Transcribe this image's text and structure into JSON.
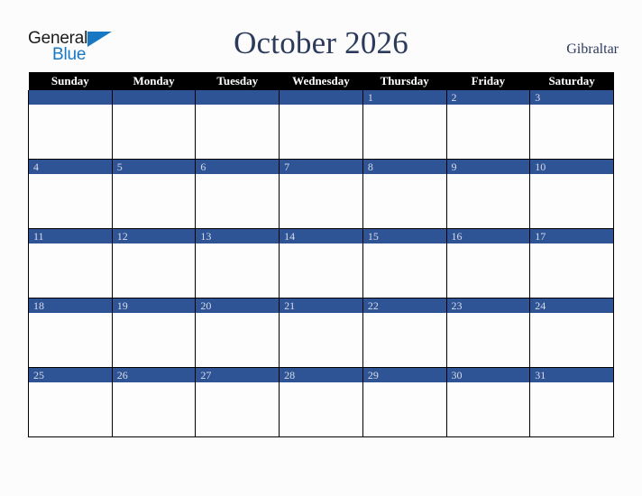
{
  "brand": {
    "name_part1": "General",
    "name_part2": "Blue",
    "triangle_icon": "triangle-icon",
    "primary_color": "#1878c4",
    "text_color": "#1b1b1b"
  },
  "header": {
    "title": "October 2026",
    "month": "October",
    "year": "2026",
    "location": "Gibraltar",
    "title_color": "#2c3a5c"
  },
  "calendar": {
    "weekday_headers": [
      "Sunday",
      "Monday",
      "Tuesday",
      "Wednesday",
      "Thursday",
      "Friday",
      "Saturday"
    ],
    "header_bg": "#000000",
    "header_text_color": "#ffffff",
    "daynum_band_bg": "#2f5496",
    "daynum_text_color": "#d7dcea",
    "cell_bg": "#ffffff",
    "border_color": "#000000",
    "weeks": [
      [
        "",
        "",
        "",
        "",
        "1",
        "2",
        "3"
      ],
      [
        "4",
        "5",
        "6",
        "7",
        "8",
        "9",
        "10"
      ],
      [
        "11",
        "12",
        "13",
        "14",
        "15",
        "16",
        "17"
      ],
      [
        "18",
        "19",
        "20",
        "21",
        "22",
        "23",
        "24"
      ],
      [
        "25",
        "26",
        "27",
        "28",
        "29",
        "30",
        "31"
      ]
    ]
  }
}
